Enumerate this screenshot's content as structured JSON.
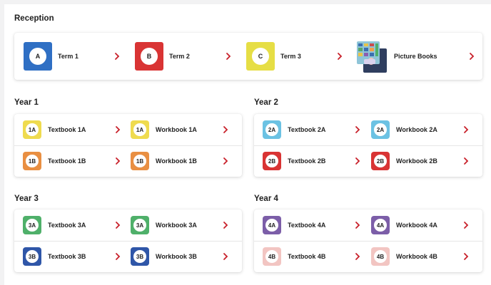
{
  "reception": {
    "title": "Reception",
    "items": [
      {
        "badge": "A",
        "label": "Term 1",
        "color": "#2f6fc4"
      },
      {
        "badge": "B",
        "label": "Term 2",
        "color": "#d93434"
      },
      {
        "badge": "C",
        "label": "Term 3",
        "color": "#e6de45"
      },
      {
        "badge": "",
        "label": "Picture Books",
        "color": "#2f3e5f"
      }
    ]
  },
  "years": [
    {
      "title": "Year 1",
      "items": [
        {
          "badge": "1A",
          "label": "Textbook 1A",
          "color": "#efdb4f"
        },
        {
          "badge": "1A",
          "label": "Workbook 1A",
          "color": "#efdb4f"
        },
        {
          "badge": "1B",
          "label": "Textbook 1B",
          "color": "#e98f42"
        },
        {
          "badge": "1B",
          "label": "Workbook 1B",
          "color": "#e98f42"
        }
      ]
    },
    {
      "title": "Year 2",
      "items": [
        {
          "badge": "2A",
          "label": "Textbook 2A",
          "color": "#6cc2e3"
        },
        {
          "badge": "2A",
          "label": "Workbook 2A",
          "color": "#6cc2e3"
        },
        {
          "badge": "2B",
          "label": "Textbook 2B",
          "color": "#d93434"
        },
        {
          "badge": "2B",
          "label": "Workbook 2B",
          "color": "#d93434"
        }
      ]
    },
    {
      "title": "Year 3",
      "items": [
        {
          "badge": "3A",
          "label": "Textbook 3A",
          "color": "#4fb06a"
        },
        {
          "badge": "3A",
          "label": "Workbook 3A",
          "color": "#4fb06a"
        },
        {
          "badge": "3B",
          "label": "Textbook 3B",
          "color": "#2f56a8"
        },
        {
          "badge": "3B",
          "label": "Workbook 3B",
          "color": "#2f56a8"
        }
      ]
    },
    {
      "title": "Year 4",
      "items": [
        {
          "badge": "4A",
          "label": "Textbook 4A",
          "color": "#7c5ea8"
        },
        {
          "badge": "4A",
          "label": "Workbook 4A",
          "color": "#7c5ea8"
        },
        {
          "badge": "4B",
          "label": "Textbook 4B",
          "color": "#f2c5c2"
        },
        {
          "badge": "4B",
          "label": "Workbook 4B",
          "color": "#f2c5c2"
        }
      ]
    }
  ],
  "icons": {
    "chevron": "chevron-right-icon",
    "chevron_color": "#c8202a"
  }
}
